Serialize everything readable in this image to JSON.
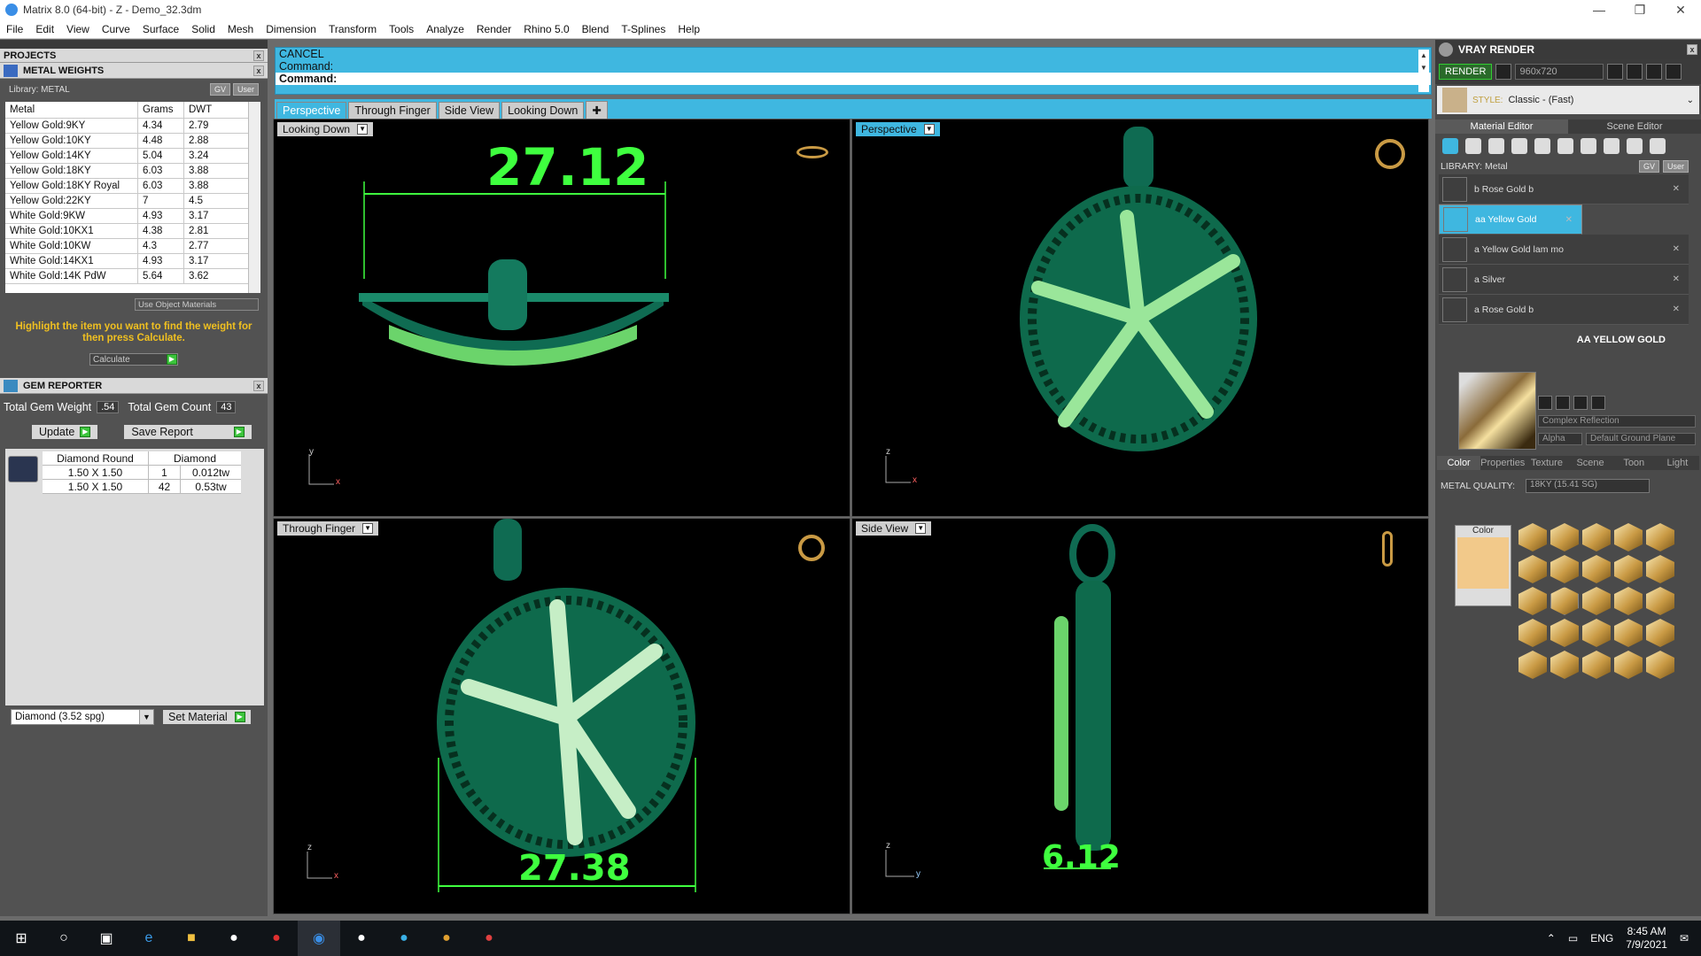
{
  "window": {
    "title": "Matrix 8.0 (64-bit) - Z - Demo_32.3dm"
  },
  "menu": [
    "File",
    "Edit",
    "View",
    "Curve",
    "Surface",
    "Solid",
    "Mesh",
    "Dimension",
    "Transform",
    "Tools",
    "Analyze",
    "Render",
    "Rhino 5.0",
    "Blend",
    "T-Splines",
    "Help"
  ],
  "projects": {
    "title": "PROJECTS"
  },
  "metal_weights": {
    "title": "METAL WEIGHTS",
    "library": "Library: METAL",
    "gv": "GV",
    "user": "User",
    "headers": [
      "Metal",
      "Grams",
      "DWT"
    ],
    "rows": [
      [
        "Yellow Gold:9KY",
        "4.34",
        "2.79"
      ],
      [
        "Yellow Gold:10KY",
        "4.48",
        "2.88"
      ],
      [
        "Yellow Gold:14KY",
        "5.04",
        "3.24"
      ],
      [
        "Yellow Gold:18KY",
        "6.03",
        "3.88"
      ],
      [
        "Yellow Gold:18KY Royal",
        "6.03",
        "3.88"
      ],
      [
        "Yellow Gold:22KY",
        "7",
        "4.5"
      ],
      [
        "White Gold:9KW",
        "4.93",
        "3.17"
      ],
      [
        "White Gold:10KX1",
        "4.38",
        "2.81"
      ],
      [
        "White Gold:10KW",
        "4.3",
        "2.77"
      ],
      [
        "White Gold:14KX1",
        "4.93",
        "3.17"
      ],
      [
        "White Gold:14K PdW",
        "5.64",
        "3.62"
      ]
    ],
    "use_object_materials": "Use Object Materials",
    "hint": "Highlight the item you want to find the weight for then press Calculate.",
    "calculate": "Calculate"
  },
  "gem_reporter": {
    "title": "GEM REPORTER",
    "total_weight_label": "Total Gem Weight",
    "total_weight": ".54",
    "total_count_label": "Total Gem Count",
    "total_count": "43",
    "update": "Update",
    "save_report": "Save Report",
    "headers": [
      "Diamond Round",
      "Diamond"
    ],
    "rows": [
      [
        "1.50 X 1.50",
        "1",
        "0.012tw"
      ],
      [
        "1.50 X 1.50",
        "42",
        "0.53tw"
      ]
    ],
    "material_select": "Diamond    (3.52 spg)",
    "set_material": "Set Material"
  },
  "command": {
    "line1": "CANCEL",
    "line2": "Command:",
    "line3": "Command:"
  },
  "view_tabs": [
    "Perspective",
    "Through Finger",
    "Side View",
    "Looking Down"
  ],
  "viewports": {
    "tl": {
      "label": "Looking Down",
      "dim": "27.12",
      "axis_v": "y",
      "axis_h": "x"
    },
    "tr": {
      "label": "Perspective",
      "axis_v": "z",
      "axis_h": "x"
    },
    "bl": {
      "label": "Through Finger",
      "dim": "27.38",
      "axis_v": "z",
      "axis_h": "x"
    },
    "br": {
      "label": "Side View",
      "dim": "6.12",
      "axis_v": "z",
      "axis_h": "y"
    }
  },
  "vray": {
    "title": "VRAY RENDER",
    "render": "RENDER",
    "resolution": "960x720",
    "style_label": "STYLE:",
    "style_value": "Classic - (Fast)",
    "tabs": [
      "Material Editor",
      "Scene Editor"
    ],
    "library": "LIBRARY: Metal",
    "gv": "GV",
    "user": "User",
    "materials": [
      "b Rose Gold b",
      "aa Yellow Gold",
      "a Yellow Gold lam mo",
      "a Silver",
      "a Rose Gold b"
    ],
    "selected_name": "AA YELLOW GOLD",
    "reflection": "Complex Reflection",
    "alpha": "Alpha",
    "ground": "Default Ground Plane",
    "subtabs": [
      "Color",
      "Properties",
      "Texture",
      "Scene",
      "Toon",
      "Light"
    ],
    "metal_quality_label": "METAL QUALITY:",
    "metal_quality": "18KY        (15.41 SG)",
    "color_label": "Color",
    "color_swatch": "#f2c98a"
  },
  "taskbar": {
    "lang": "ENG",
    "time": "8:45 AM",
    "date": "7/9/2021"
  }
}
